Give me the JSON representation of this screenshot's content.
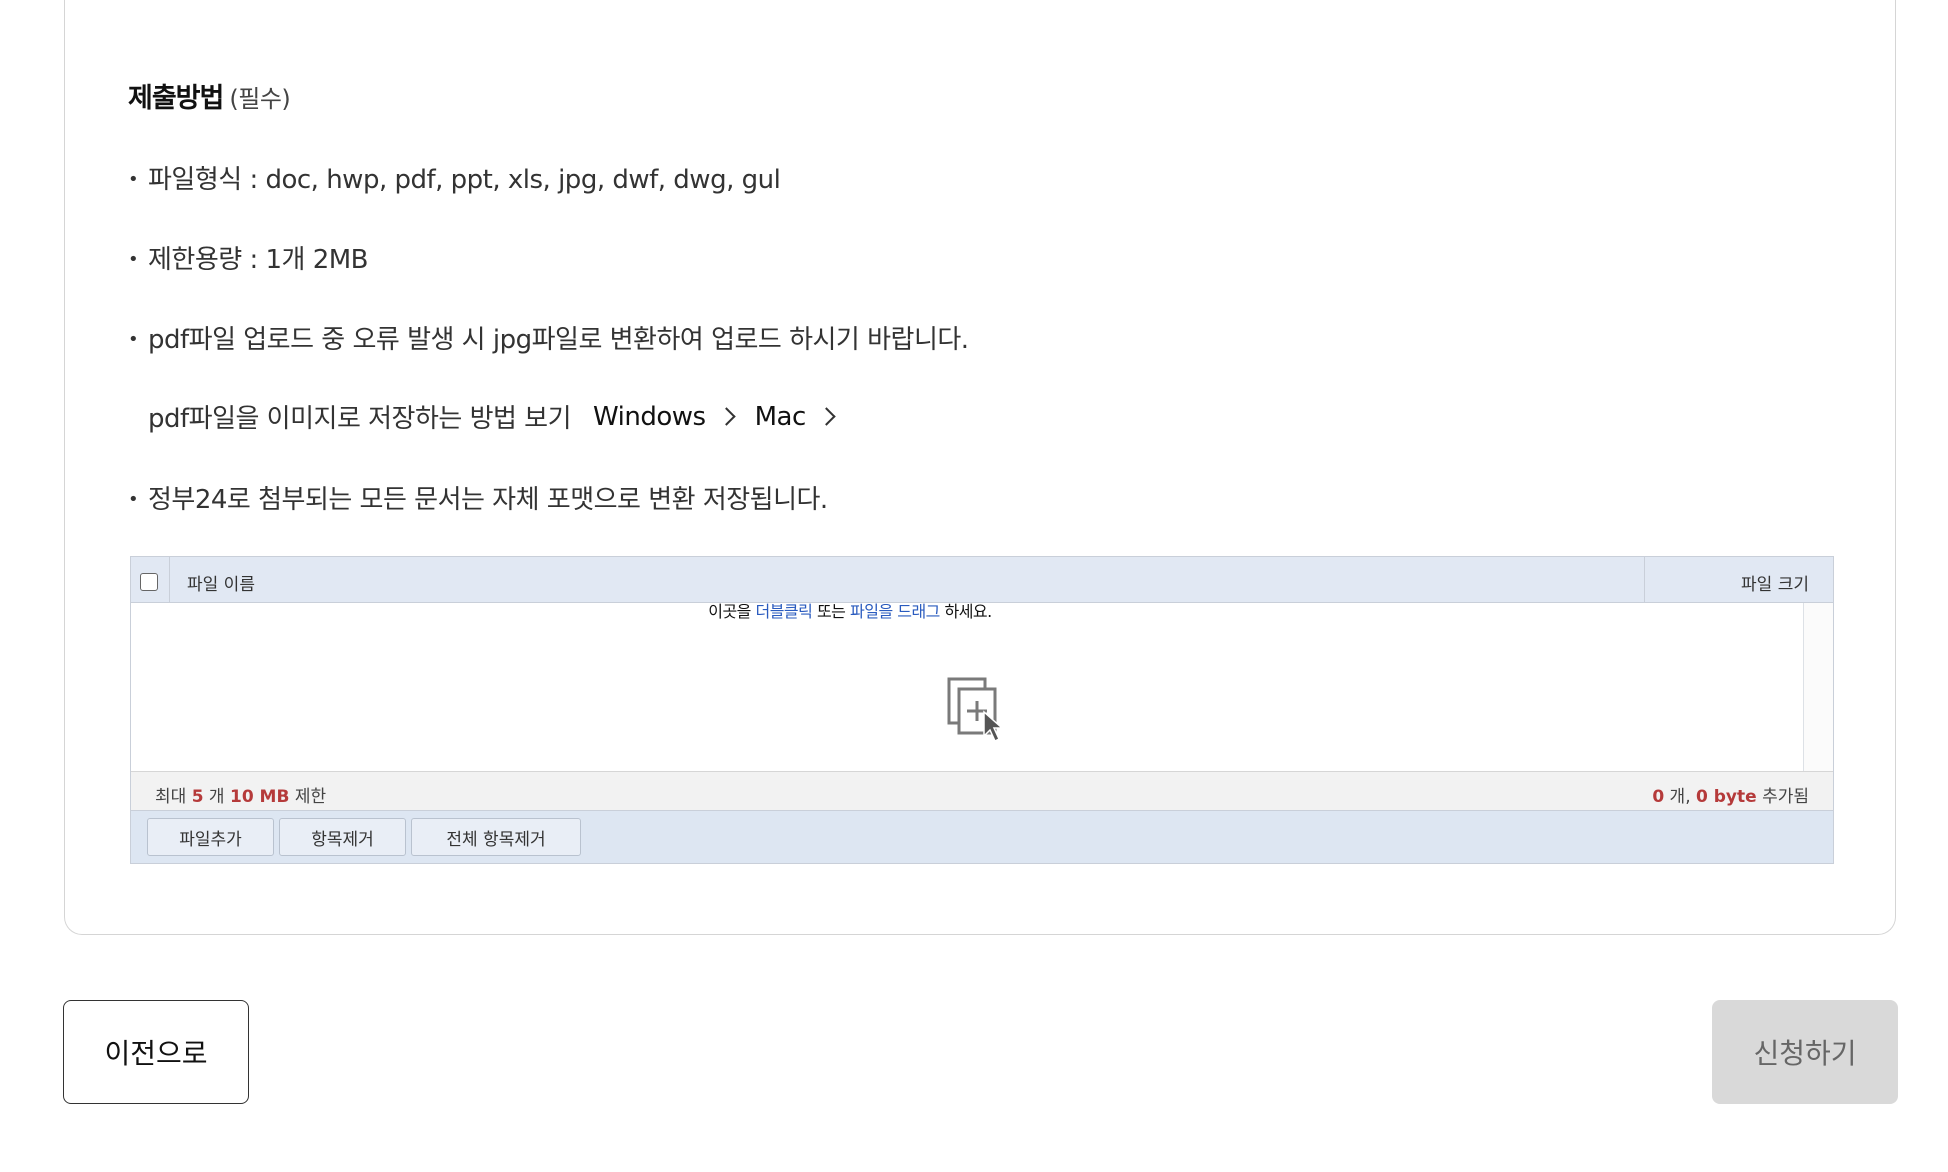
{
  "section": {
    "title": "제출방법",
    "required": "(필수)"
  },
  "bullets": {
    "file_format": "파일형식 : doc, hwp, pdf, ppt, xls, jpg, dwf, dwg, gul",
    "size_limit": "제한용량 : 1개 2MB",
    "pdf_error": "pdf파일 업로드 중 오류 발생 시 jpg파일로 변환하여 업로드 하시기 바랍니다.",
    "howto_label": "pdf파일을 이미지로 저장하는 방법 보기",
    "link_windows": "Windows",
    "link_mac": "Mac",
    "convert_note": "정부24로 첨부되는 모든 문서는 자체 포맷으로 변환 저장됩니다."
  },
  "uploader": {
    "col_name": "파일 이름",
    "col_size": "파일 크기",
    "hint_pre": "이곳을 ",
    "hint_dblclick": "더블클릭",
    "hint_mid": " 또는 ",
    "hint_drag": "파일을 드래그",
    "hint_post": " 하세요.",
    "status": {
      "max_prefix": "최대 ",
      "max_count": "5",
      "max_count_unit": " 개 ",
      "max_size": "10 MB",
      "max_suffix": " 제한",
      "added_count": "0",
      "added_count_unit": " 개, ",
      "added_size": "0 byte",
      "added_suffix": " 추가됨"
    },
    "buttons": {
      "add": "파일추가",
      "remove": "항목제거",
      "remove_all": "전체 항목제거"
    }
  },
  "nav": {
    "prev": "이전으로",
    "submit": "신청하기"
  },
  "colors": {
    "highlight_link": "#2a5bbf",
    "status_number": "#b53a3a",
    "header_bg": "#e1e8f3",
    "submit_disabled_bg": "#d9d9d9"
  }
}
